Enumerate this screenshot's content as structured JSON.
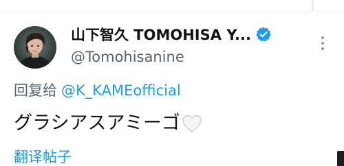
{
  "tweet": {
    "display_name": "山下智久 TOMOHISA Y...",
    "handle": "@Tomohisanine",
    "reply_prefix": "回复给",
    "reply_to": "@K_KAMEofficial",
    "text": "グラシアスアミーゴ",
    "text_emoji": "white-heart-icon",
    "translate_label": "翻译帖子"
  },
  "icons": {
    "verified": "verified-badge-icon",
    "more": "more-vertical-icon",
    "avatar": "avatar-image"
  },
  "colors": {
    "primary_text": "#0f1419",
    "secondary_text": "#536471",
    "link": "#1d9bf0",
    "verified": "#1d9bf0"
  }
}
